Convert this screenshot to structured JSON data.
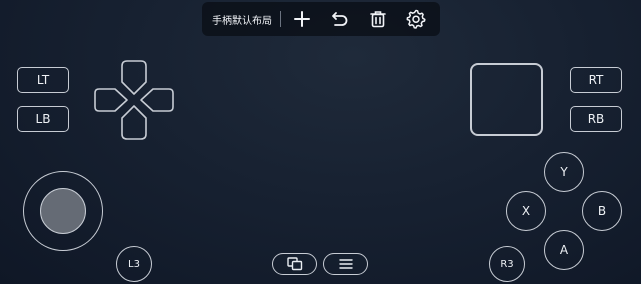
{
  "toolbar": {
    "layout_name": "手柄默认布局",
    "icons": [
      "plus-icon",
      "undo-icon",
      "trash-icon",
      "gear-icon"
    ]
  },
  "buttons": {
    "lt": "LT",
    "lb": "LB",
    "rt": "RT",
    "rb": "RB",
    "y": "Y",
    "x": "X",
    "b": "B",
    "a": "A",
    "l3": "L3",
    "r3": "R3"
  },
  "bottom_icons": [
    "view-icon",
    "menu-icon"
  ],
  "colors": {
    "outline": "#c7ccd4",
    "background": "#172131",
    "toolbar_bg": "#080c14"
  }
}
